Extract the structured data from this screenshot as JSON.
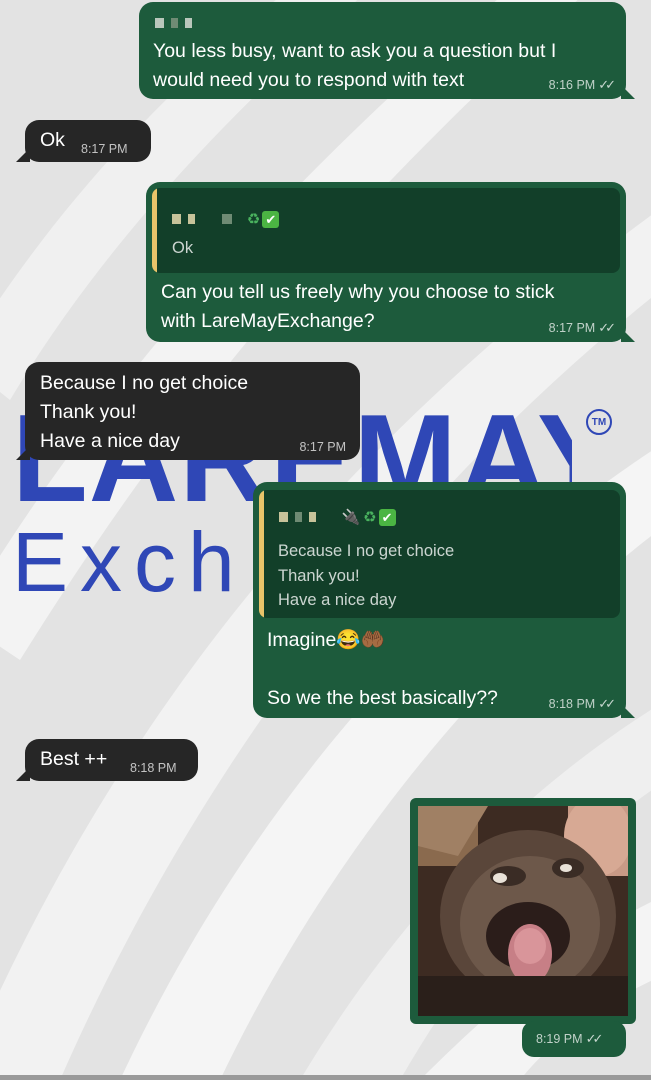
{
  "colors": {
    "outgoing_bubble": "#1d5b3c",
    "incoming_bubble": "#262626",
    "quote_background": "#123f29",
    "quote_bar": "#e9c46a",
    "brand_blue": "#2f47b6",
    "wallpaper": "#e6e6e6"
  },
  "wallpaper": {
    "brand_top": "LAREMAY",
    "brand_bottom": "Exch",
    "trademark": "TM"
  },
  "messages": [
    {
      "id": "m1",
      "direction": "outgoing",
      "text_lines": [
        "You less busy, want to ask you a question but I",
        "would need you to respond with text"
      ],
      "time": "8:16 PM",
      "status_icon": "double-check-icon"
    },
    {
      "id": "m2",
      "direction": "incoming",
      "text": "Ok",
      "time": "8:17 PM"
    },
    {
      "id": "m3",
      "direction": "outgoing",
      "quote": {
        "sender_emojis": "♻✅",
        "text": "Ok"
      },
      "text_lines": [
        "Can you tell us freely why you choose to stick",
        "with LareMayExchange?"
      ],
      "time": "8:17 PM",
      "status_icon": "double-check-icon"
    },
    {
      "id": "m4",
      "direction": "incoming",
      "text_lines": [
        "Because I no get choice",
        "Thank you!",
        "Have a nice day"
      ],
      "time": "8:17 PM"
    },
    {
      "id": "m5",
      "direction": "outgoing",
      "quote": {
        "sender_emojis": "♻✅",
        "text_lines": [
          "Because I no get choice",
          "Thank you!",
          "Have a nice day"
        ]
      },
      "text_lines": [
        "Imagine😂🤲🏾",
        "",
        "So we the best basically??"
      ],
      "time": "8:18 PM",
      "status_icon": "double-check-icon"
    },
    {
      "id": "m6",
      "direction": "incoming",
      "text": "Best ++",
      "time": "8:18 PM"
    },
    {
      "id": "m7",
      "direction": "outgoing",
      "type": "image",
      "image_subject": "monkey-meme-image",
      "time": "8:19 PM",
      "status_icon": "double-check-icon"
    }
  ]
}
